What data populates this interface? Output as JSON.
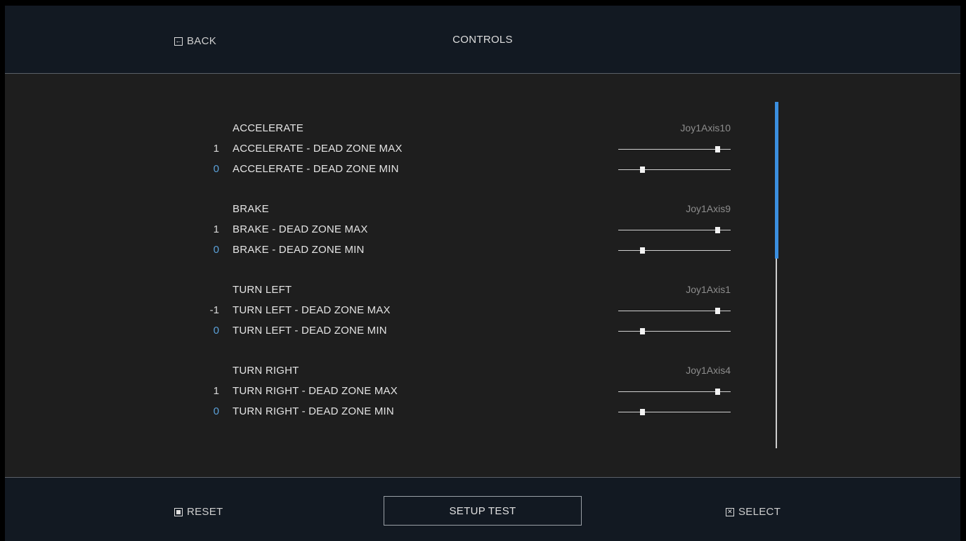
{
  "header": {
    "back_label": "BACK",
    "title": "CONTROLS"
  },
  "groups": [
    {
      "action": "ACCELERATE",
      "binding": "Joy1Axis10",
      "max": {
        "value": "1",
        "label": "ACCELERATE - DEAD ZONE MAX",
        "level": 0.88
      },
      "min": {
        "value": "0",
        "label": "ACCELERATE - DEAD ZONE MIN",
        "level": 0.21
      }
    },
    {
      "action": "BRAKE",
      "binding": "Joy1Axis9",
      "max": {
        "value": "1",
        "label": "BRAKE - DEAD ZONE MAX",
        "level": 0.88
      },
      "min": {
        "value": "0",
        "label": "BRAKE - DEAD ZONE MIN",
        "level": 0.21
      }
    },
    {
      "action": "TURN LEFT",
      "binding": "Joy1Axis1",
      "max": {
        "value": "-1",
        "label": "TURN LEFT - DEAD ZONE MAX",
        "level": 0.88
      },
      "min": {
        "value": "0",
        "label": "TURN LEFT - DEAD ZONE MIN",
        "level": 0.21
      }
    },
    {
      "action": "TURN RIGHT",
      "binding": "Joy1Axis4",
      "max": {
        "value": "1",
        "label": "TURN RIGHT - DEAD ZONE MAX",
        "level": 0.88
      },
      "min": {
        "value": "0",
        "label": "TURN RIGHT - DEAD ZONE MIN",
        "level": 0.21
      }
    }
  ],
  "footer": {
    "reset_label": "RESET",
    "setup_test_label": "SETUP TEST",
    "select_label": "SELECT"
  },
  "scrollbar": {
    "position": 0.0,
    "visible_fraction": 0.45
  },
  "colors": {
    "accent": "#3b8fe0",
    "min_value": "#5aa0d8",
    "bar_bg": "#121922",
    "panel_bg": "#1e1e1e"
  }
}
